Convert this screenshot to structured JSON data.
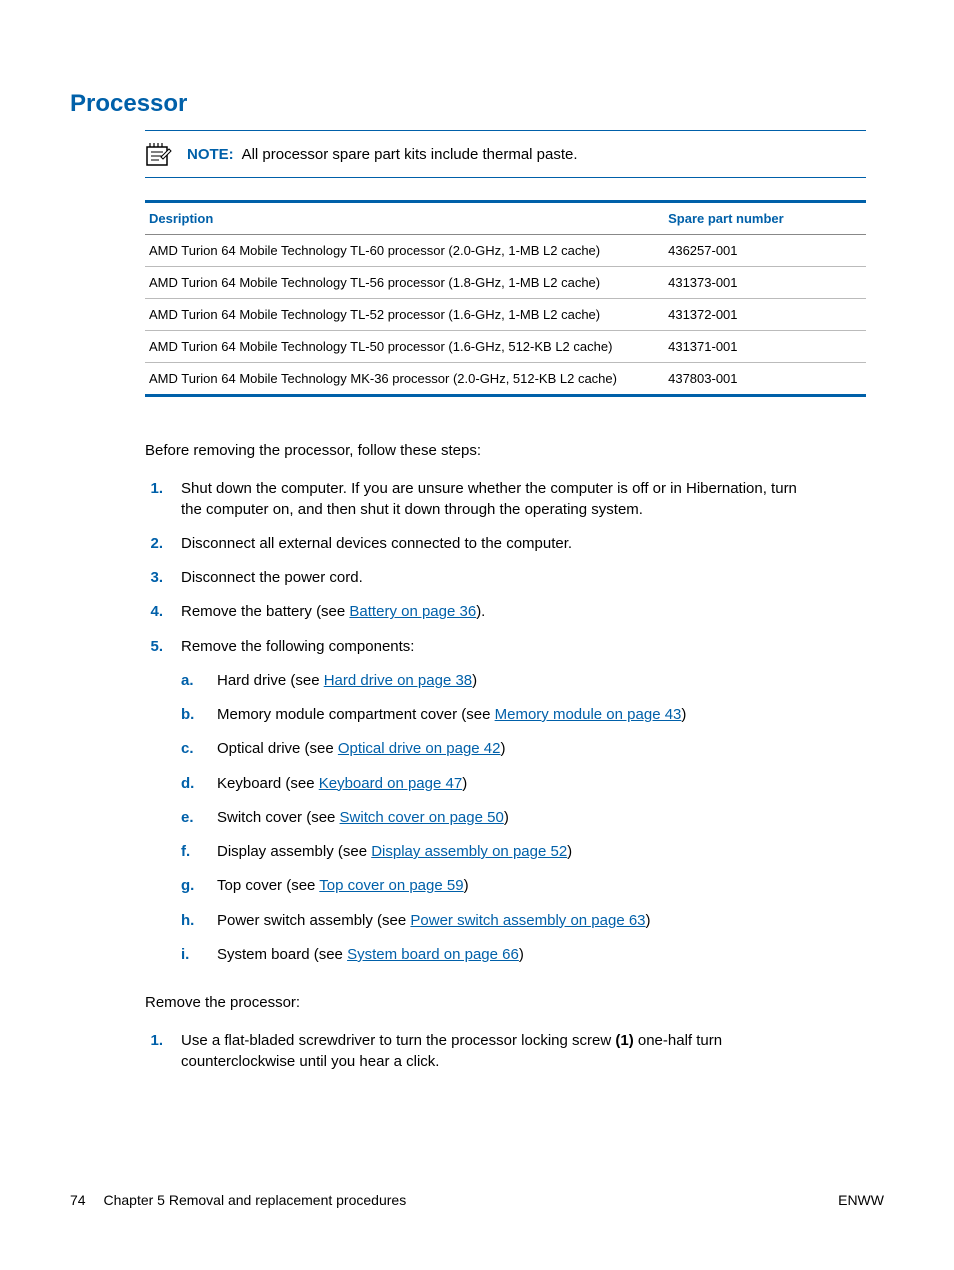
{
  "heading": "Processor",
  "note": {
    "label": "NOTE:",
    "text": "All processor spare part kits include thermal paste."
  },
  "table": {
    "headers": {
      "description": "Desription",
      "spare": "Spare part number"
    },
    "rows": [
      {
        "desc": "AMD Turion 64 Mobile Technology TL-60 processor (2.0-GHz, 1-MB L2 cache)",
        "spare": "436257-001"
      },
      {
        "desc": "AMD Turion 64 Mobile Technology TL-56 processor (1.8-GHz, 1-MB L2 cache)",
        "spare": "431373-001"
      },
      {
        "desc": "AMD Turion 64 Mobile Technology TL-52 processor (1.6-GHz, 1-MB L2 cache)",
        "spare": "431372-001"
      },
      {
        "desc": "AMD Turion 64 Mobile Technology TL-50 processor (1.6-GHz, 512-KB L2 cache)",
        "spare": "431371-001"
      },
      {
        "desc": "AMD Turion 64 Mobile Technology MK-36 processor (2.0-GHz, 512-KB L2 cache)",
        "spare": "437803-001"
      }
    ]
  },
  "intro": "Before removing the processor, follow these steps:",
  "steps1": {
    "m1": "1.",
    "t1": "Shut down the computer. If you are unsure whether the computer is off or in Hibernation, turn the computer on, and then shut it down through the operating system.",
    "m2": "2.",
    "t2": "Disconnect all external devices connected to the computer.",
    "m3": "3.",
    "t3": "Disconnect the power cord.",
    "m4": "4.",
    "t4a": "Remove the battery (see ",
    "t4link": "Battery on page 36",
    "t4b": ").",
    "m5": "5.",
    "t5": "Remove the following components:"
  },
  "sub": {
    "a": {
      "m": "a.",
      "pre": "Hard drive (see ",
      "link": "Hard drive on page 38",
      "post": ")"
    },
    "b": {
      "m": "b.",
      "pre": "Memory module compartment cover (see ",
      "link": "Memory module on page 43",
      "post": ")"
    },
    "c": {
      "m": "c.",
      "pre": "Optical drive (see ",
      "link": "Optical drive on page 42",
      "post": ")"
    },
    "d": {
      "m": "d.",
      "pre": "Keyboard (see ",
      "link": "Keyboard on page 47",
      "post": ")"
    },
    "e": {
      "m": "e.",
      "pre": "Switch cover (see ",
      "link": "Switch cover on page 50",
      "post": ")"
    },
    "f": {
      "m": "f.",
      "pre": "Display assembly (see ",
      "link": "Display assembly on page 52",
      "post": ")"
    },
    "g": {
      "m": "g.",
      "pre": "Top cover (see ",
      "link": "Top cover on page 59",
      "post": ")"
    },
    "h": {
      "m": "h.",
      "pre": "Power switch assembly (see ",
      "link": "Power switch assembly on page 63",
      "post": ")"
    },
    "i": {
      "m": "i.",
      "pre": "System board (see ",
      "link": "System board on page 66",
      "post": ")"
    }
  },
  "remove_heading": "Remove the processor:",
  "steps2": {
    "m1": "1.",
    "t1a": "Use a flat-bladed screwdriver to turn the processor locking screw ",
    "t1bold": "(1)",
    "t1b": " one-half turn counterclockwise until you hear a click."
  },
  "footer": {
    "page_num": "74",
    "chapter": "Chapter 5   Removal and replacement procedures",
    "right": "ENWW"
  }
}
